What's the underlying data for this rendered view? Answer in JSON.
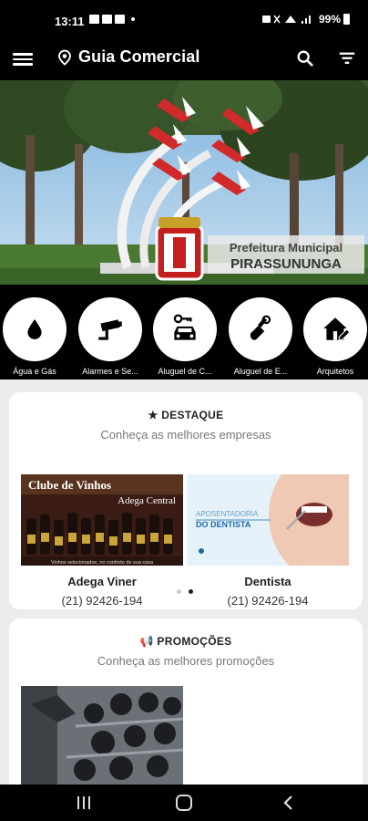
{
  "status": {
    "time": "13:11",
    "battery": "99%"
  },
  "header": {
    "title": "Guia Comercial"
  },
  "banner": {
    "line1": "Prefeitura Municipal",
    "line2": "PIRASSUNUNGA"
  },
  "categories": [
    {
      "label": "Água e Gás",
      "icon": "water-drop-icon"
    },
    {
      "label": "Alarmes e Se...",
      "icon": "security-camera-icon"
    },
    {
      "label": "Aluguel de C...",
      "icon": "car-key-icon"
    },
    {
      "label": "Aluguel de E...",
      "icon": "equipment-icon"
    },
    {
      "label": "Arquitetos",
      "icon": "house-pencil-icon"
    }
  ],
  "destaque": {
    "title": "DESTAQUE",
    "subtitle": "Conheça as melhores empresas",
    "items": [
      {
        "name": "Adega Viner",
        "phone": "(21) 92426-194",
        "ad_title": "Clube de Vinhos",
        "ad_sub": "Adega Central",
        "ad_caption": "Vinhos selecionados, no conforto de sua casa"
      },
      {
        "name": "Dentista",
        "phone": "(21) 92426-194",
        "ad_line1": "APOSENTADORIA",
        "ad_line2": "DO DENTISTA"
      }
    ]
  },
  "promocoes": {
    "title": "PROMOÇÕES",
    "subtitle": "Conheça as melhores promoções"
  },
  "colors": {
    "background": "#000000",
    "content_bg": "#ececec",
    "card_bg": "#ffffff"
  }
}
